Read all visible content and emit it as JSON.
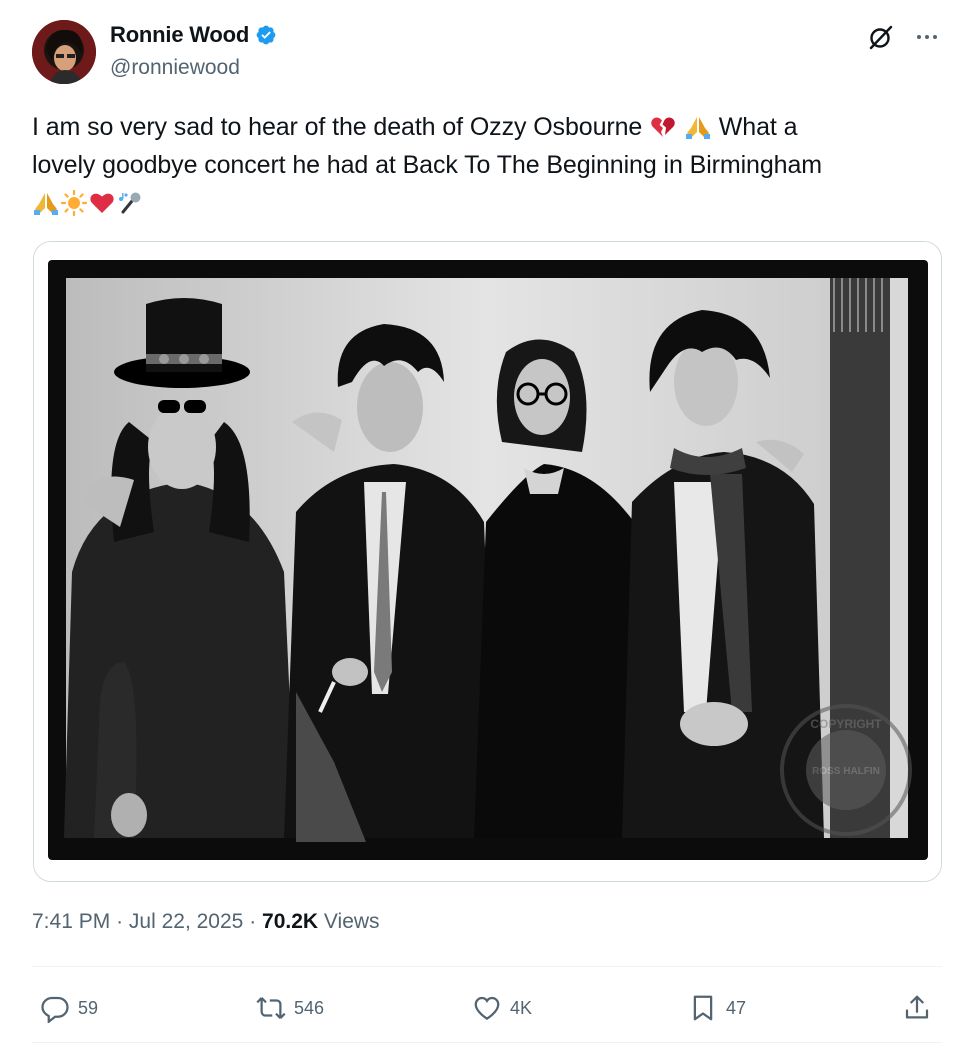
{
  "author": {
    "display_name": "Ronnie Wood",
    "handle": "@ronniewood",
    "verified": true
  },
  "tweet": {
    "text_line1": "I am so very sad to hear of the death of Ozzy Osbourne",
    "text_line1_end": "What a",
    "text_line2": "lovely goodbye concert he had at Back To The Beginning in Birmingham",
    "emojis_line1": [
      "broken-heart",
      "folded-hands"
    ],
    "emojis_line3": [
      "folded-hands",
      "sun",
      "red-heart",
      "microphone-notes"
    ]
  },
  "media": {
    "alt": "Black and white photo of four musicians",
    "watermark_text": [
      "COPYRIGHT",
      "ROSS HALFIN"
    ]
  },
  "meta": {
    "time": "7:41 PM",
    "separator": "·",
    "date": "Jul 22, 2025",
    "views_count": "70.2K",
    "views_label": "Views"
  },
  "actions": {
    "replies": "59",
    "reposts": "546",
    "likes": "4K",
    "bookmarks": "47"
  },
  "colors": {
    "text": "#0f1419",
    "secondary": "#536471",
    "verified": "#1d9bf0",
    "divider": "#eff3f4"
  }
}
